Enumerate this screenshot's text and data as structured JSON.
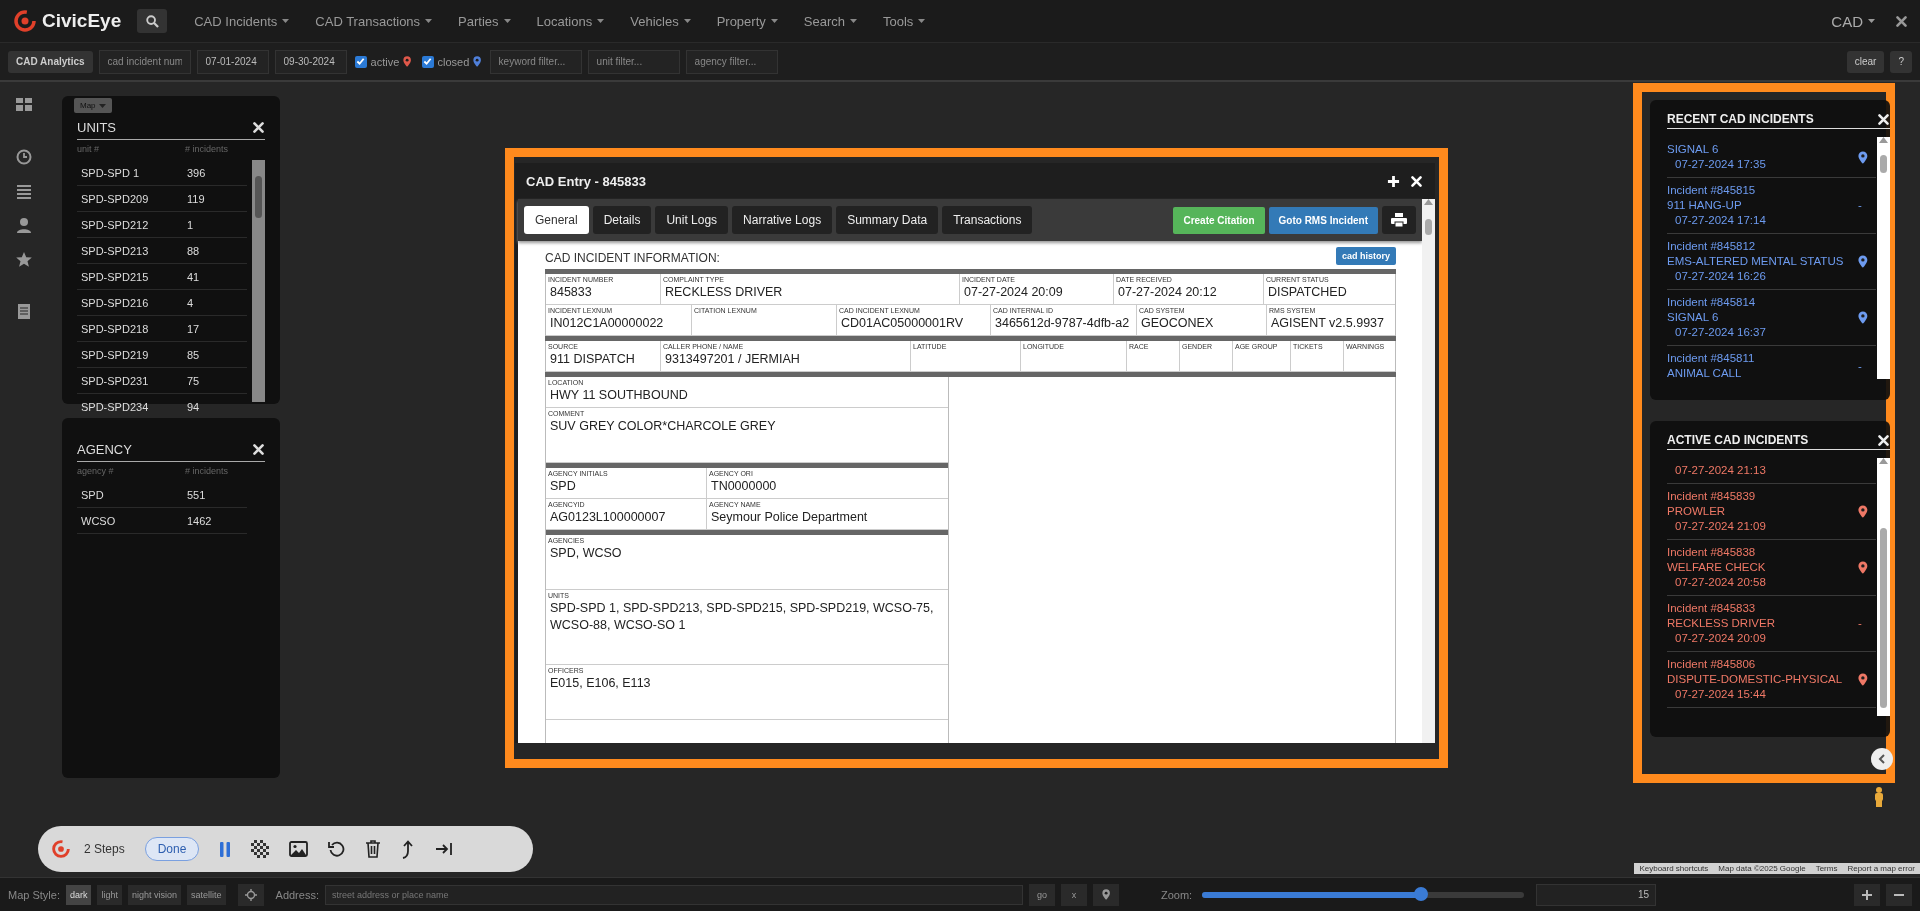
{
  "nav": {
    "logo": "CivicEye",
    "menu": [
      {
        "label": "CAD Incidents"
      },
      {
        "label": "CAD Transactions"
      },
      {
        "label": "Parties"
      },
      {
        "label": "Locations"
      },
      {
        "label": "Vehicles"
      },
      {
        "label": "Property"
      },
      {
        "label": "Search"
      },
      {
        "label": "Tools"
      }
    ],
    "module": "CAD"
  },
  "filters": {
    "analytics_button": "CAD Analytics",
    "incident_num": {
      "placeholder": "cad incident num"
    },
    "start_date": {
      "value": "07-01-2024"
    },
    "end_date": {
      "value": "09-30-2024"
    },
    "status_filters": [
      {
        "label": "active",
        "checked": true,
        "color": "#e0584a"
      },
      {
        "label": "closed",
        "checked": true,
        "color": "#4f7fd9"
      }
    ],
    "text_filters": [
      {
        "placeholder": "keyword filter..."
      },
      {
        "placeholder": "unit filter..."
      },
      {
        "placeholder": "agency filter..."
      }
    ],
    "clear": "clear",
    "help": "?"
  },
  "map_type_button": "Map",
  "units_panel": {
    "title": "UNITS",
    "columns": [
      "unit #",
      "# incidents"
    ],
    "rows": [
      [
        "SPD-SPD 1",
        "396"
      ],
      [
        "SPD-SPD209",
        "119"
      ],
      [
        "SPD-SPD212",
        "1"
      ],
      [
        "SPD-SPD213",
        "88"
      ],
      [
        "SPD-SPD215",
        "41"
      ],
      [
        "SPD-SPD216",
        "4"
      ],
      [
        "SPD-SPD218",
        "17"
      ],
      [
        "SPD-SPD219",
        "85"
      ],
      [
        "SPD-SPD231",
        "75"
      ],
      [
        "SPD-SPD234",
        "94"
      ]
    ]
  },
  "agency_panel": {
    "title": "AGENCY",
    "columns": [
      "agency #",
      "# incidents"
    ],
    "rows": [
      [
        "SPD",
        "551"
      ],
      [
        "WCSO",
        "1462"
      ]
    ]
  },
  "dialog": {
    "title": "CAD Entry - 845833",
    "tabs": [
      {
        "label": "General",
        "selected": true
      },
      {
        "label": "Details",
        "selected": false
      },
      {
        "label": "Unit Logs",
        "selected": false
      },
      {
        "label": "Narrative Logs",
        "selected": false
      },
      {
        "label": "Summary Data",
        "selected": false
      },
      {
        "label": "Transactions",
        "selected": false
      }
    ],
    "actions": [
      {
        "label": "Create Citation",
        "kind": "success"
      },
      {
        "label": "Goto RMS Incident",
        "kind": "primary"
      }
    ],
    "heading": "CAD INCIDENT INFORMATION:",
    "history_button": "cad history",
    "top_sections": [
      [
        [
          {
            "label": "INCIDENT NUMBER",
            "value": "845833"
          },
          {
            "label": "COMPLAINT TYPE",
            "value": "RECKLESS DRIVER"
          },
          {
            "label": "INCIDENT DATE",
            "value": "07-27-2024 20:09"
          },
          {
            "label": "DATE RECEIVED",
            "value": "07-27-2024 20:12"
          },
          {
            "label": "CURRENT STATUS",
            "value": "DISPATCHED"
          }
        ],
        [
          {
            "label": "INCIDENT LEXNUM",
            "value": "IN012C1A00000022"
          },
          {
            "label": "CITATION LEXNUM"
          },
          {
            "label": "CAD INCIDENT LEXNUM",
            "value": "CD01AC05000001RV"
          },
          {
            "label": "CAD INTERNAL ID",
            "value": "3465612d-9787-4dfb-a2"
          },
          {
            "label": "CAD SYSTEM",
            "value": "GEOCONEX"
          },
          {
            "label": "RMS SYSTEM",
            "value": "AGISENT v2.5.9937"
          }
        ]
      ],
      [
        [
          {
            "label": "SOURCE",
            "value": "911 DISPATCH"
          },
          {
            "label": "CALLER PHONE / NAME",
            "value": "9313497201 / JERMIAH"
          },
          {
            "label": "LATITUDE"
          },
          {
            "label": "LONGITUDE"
          },
          {
            "label": "RACE"
          },
          {
            "label": "GENDER"
          },
          {
            "label": "AGE GROUP"
          },
          {
            "label": "TICKETS"
          },
          {
            "label": "WARNINGS"
          }
        ]
      ]
    ],
    "left_sections": [
      [
        [
          {
            "label": "LOCATION",
            "value": "HWY 11 SOUTHBOUND",
            "kind": "line"
          }
        ],
        [
          {
            "label": "COMMENT",
            "value": "SUV GREY COLOR*CHARCOLE GREY",
            "kind": "area"
          }
        ]
      ],
      [
        [
          {
            "label": "AGENCY INITIALS",
            "value": "SPD",
            "kind": "line"
          },
          {
            "label": "AGENCY ORI",
            "value": "TN0000000",
            "kind": "line"
          }
        ],
        [
          {
            "label": "AGENCYID",
            "value": "AG0123L100000007",
            "kind": "line"
          },
          {
            "label": "AGENCY NAME",
            "value": "Seymour Police Department",
            "kind": "line"
          }
        ]
      ],
      [
        [
          {
            "label": "AGENCIES",
            "value": "SPD, WCSO",
            "kind": "area"
          }
        ],
        [
          {
            "label": "UNITS",
            "value": "SPD-SPD 1, SPD-SPD213, SPD-SPD215, SPD-SPD219, WCSO-75, WCSO-88, WCSO-SO 1",
            "kind": "tall"
          }
        ],
        [
          {
            "label": "OFFICERS",
            "value": "E015, E106, E113",
            "kind": "area"
          }
        ]
      ]
    ]
  },
  "recent_incidents": {
    "title": "RECENT CAD INCIDENTS",
    "items": [
      {
        "type": "SIGNAL 6",
        "time": "07-27-2024 17:35",
        "mapped": true
      },
      {
        "incident": "Incident #845815",
        "type": "911 HANG-UP",
        "time": "07-27-2024 17:14",
        "mapped": false,
        "dash": "-"
      },
      {
        "incident": "Incident #845812",
        "type": "EMS-ALTERED MENTAL STATUS",
        "time": "07-27-2024 16:26",
        "mapped": true
      },
      {
        "incident": "Incident #845814",
        "type": "SIGNAL 6",
        "time": "07-27-2024 16:37",
        "mapped": true
      },
      {
        "incident": "Incident #845811",
        "type": "ANIMAL CALL",
        "mapped": false,
        "dash": "-"
      }
    ]
  },
  "active_incidents": {
    "title": "ACTIVE CAD INCIDENTS",
    "items": [
      {
        "time": "07-27-2024 21:13",
        "mapped": false
      },
      {
        "incident": "Incident #845839",
        "type": "PROWLER",
        "time": "07-27-2024 21:09",
        "mapped": true
      },
      {
        "incident": "Incident #845838",
        "type": "WELFARE CHECK",
        "time": "07-27-2024 20:58",
        "mapped": true
      },
      {
        "incident": "Incident #845833",
        "type": "RECKLESS DRIVER",
        "time": "07-27-2024 20:09",
        "mapped": false,
        "dash": "-"
      },
      {
        "incident": "Incident #845806",
        "type": "DISPUTE-DOMESTIC-PHYSICAL",
        "time": "07-27-2024 15:44",
        "mapped": true
      }
    ]
  },
  "tour": {
    "steps": "2 Steps",
    "done": "Done"
  },
  "attribution": [
    "Keyboard shortcuts",
    "Map data ©2025 Google",
    "Terms",
    "Report a map error"
  ],
  "map_controls": {
    "style_label": "Map Style:",
    "styles": [
      {
        "label": "dark",
        "selected": true
      },
      {
        "label": "light",
        "selected": false
      },
      {
        "label": "night vision",
        "selected": false
      },
      {
        "label": "satellite",
        "selected": false
      }
    ],
    "address_label": "Address:",
    "address": {
      "placeholder": "street address or place name"
    },
    "go": "go",
    "clear": "x",
    "zoom_label": "Zoom:",
    "zoom": {
      "level": 0.68
    },
    "zoom_value": "15"
  }
}
